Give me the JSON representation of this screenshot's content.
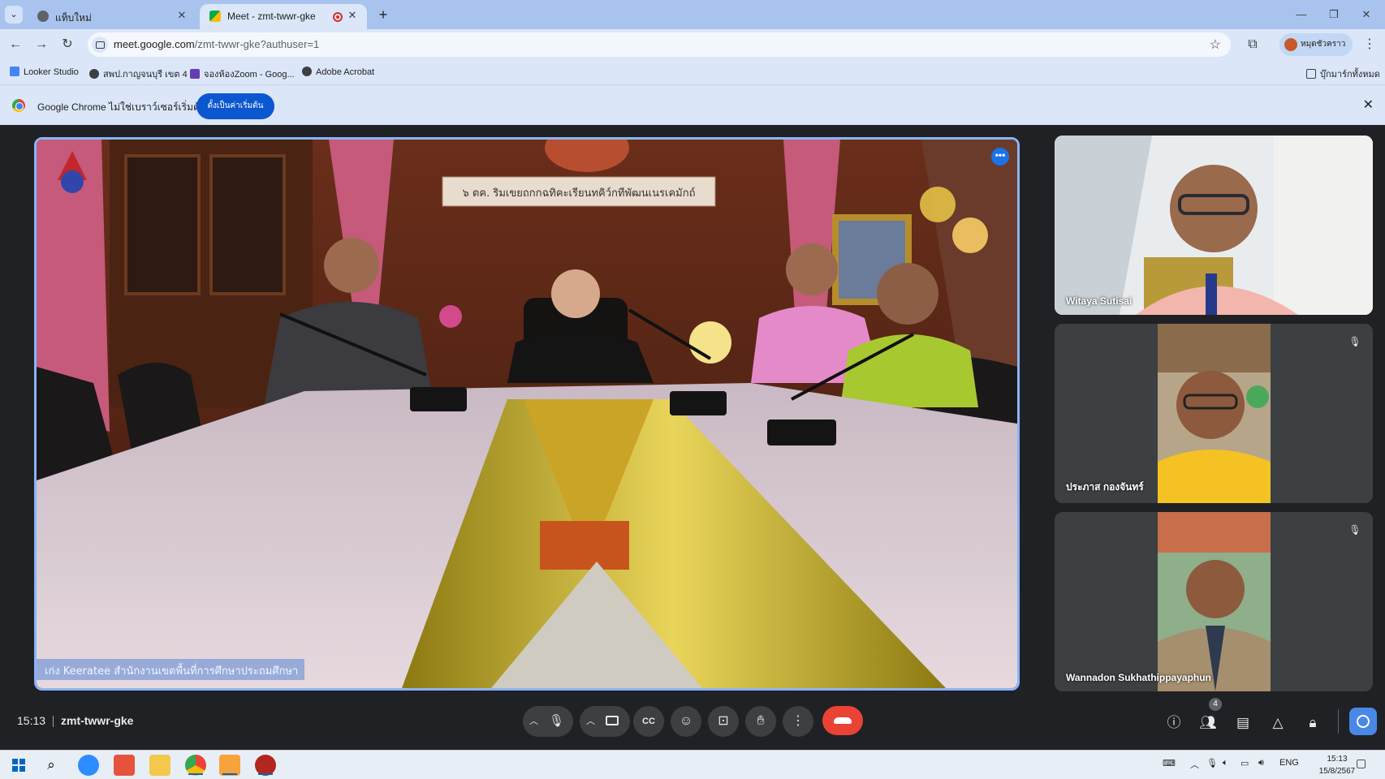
{
  "browser": {
    "tabs": [
      {
        "title": "แท็บใหม่",
        "active": false
      },
      {
        "title": "Meet - zmt-twwr-gke",
        "active": true,
        "recording": true
      }
    ],
    "url_host": "meet.google.com",
    "url_path": "/zmt-twwr-gke?authuser=1",
    "profile_name": "หมุดชัวคราว",
    "bookmarks": [
      {
        "label": "Looker Studio",
        "icon": "looker-icon"
      },
      {
        "label": "สพป.กาญจนบุรี เขต 4",
        "icon": "globe-icon"
      },
      {
        "label": "จองห้องZoom - Goog...",
        "icon": "forms-icon"
      },
      {
        "label": "Adobe Acrobat",
        "icon": "globe-icon"
      }
    ],
    "all_bookmarks_label": "บุ๊กมาร์กทั้งหมด",
    "infobar": {
      "text": "Google Chrome ไม่ใช่เบราว์เซอร์เริ่มต้น",
      "button": "ตั้งเป็นค่าเริ่มต้น"
    }
  },
  "meet": {
    "main_tile": {
      "name": "Keeratee",
      "room_sign": "๖ ตค. ริมเขยถกกฉทิคะเรียนทคิว์กทีพัฒนเนรเคมักถ์",
      "banner": "เก่ง Keeratee สำนักงานเขตพื้นที่การศึกษาประถมศึกษา"
    },
    "participants": [
      {
        "name": "Witaya Sutisai",
        "muted": false
      },
      {
        "name": "ประภาส กองจันทร์",
        "muted": true
      },
      {
        "name": "Wannadon Sukhathippayaphun",
        "muted": true
      }
    ],
    "time": "15:13",
    "meeting_code": "zmt-twwr-gke",
    "people_count": "4"
  },
  "taskbar": {
    "language": "ENG",
    "time": "15:13",
    "date": "15/8/2567"
  },
  "colors": {
    "meet_bg": "#202124",
    "active_speaker_border": "#8ab4f8",
    "end_call": "#ea4335",
    "chrome_accent": "#0b57d0"
  }
}
